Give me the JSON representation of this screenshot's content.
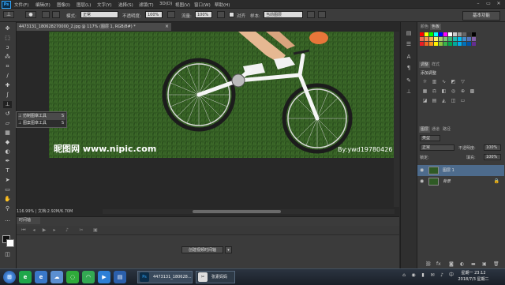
{
  "menubar": {
    "logo": "Ps",
    "items": [
      "文件(F)",
      "编辑(E)",
      "图像(I)",
      "图层(L)",
      "文字(Y)",
      "选择(S)",
      "滤镜(T)",
      "3D(D)",
      "视图(V)",
      "窗口(W)",
      "帮助(H)"
    ]
  },
  "options": {
    "mode_label": "模式:",
    "mode_value": "正常",
    "opacity_label": "不透明度:",
    "opacity_value": "100%",
    "flow_label": "流量:",
    "flow_value": "100%",
    "aligned_label": "对齐",
    "sample_label": "样本:",
    "sample_value": "当前图层",
    "workspace": "基本功能"
  },
  "document": {
    "tab_title": "4473131_180628270000_2.jpg @ 117% (图层 1, RGB/8#) *",
    "tab_close": "×",
    "status": "116.99% | 文档:2.92M/6.70M",
    "watermark_left": "昵图网 www.nipic.com",
    "watermark_right": "By:ywd19780426"
  },
  "flyout": {
    "items": [
      {
        "label": "仿制图章工具",
        "key": "S"
      },
      {
        "label": "图案图章工具",
        "key": "S"
      }
    ]
  },
  "timeline": {
    "tab": "时间轴",
    "create_button": "创建视频时间轴",
    "dropdown_arrow": "▾"
  },
  "panels": {
    "color_tabs": [
      "颜色",
      "色板"
    ],
    "adjust_tabs": [
      "调整",
      "样式"
    ],
    "adjust_title": "添加调整",
    "layers_tabs": [
      "图层",
      "通道",
      "路径"
    ],
    "kind_label": "类型",
    "blend_mode": "正常",
    "opacity_label": "不透明度:",
    "opacity_value": "100%",
    "lock_label": "锁定:",
    "fill_label": "填充:",
    "fill_value": "100%",
    "layers": [
      {
        "name": "图层 1",
        "selected": true
      },
      {
        "name": "背景",
        "selected": false
      }
    ]
  },
  "taskbar": {
    "tasks": [
      {
        "label": "4473131_180628...",
        "icon": "Ps"
      },
      {
        "label": "张素妈妈",
        "icon": "✂"
      }
    ],
    "time": "星期一 23:12",
    "date": "2018/7/3 星期二"
  },
  "colors": {
    "accent": "#31a8ff",
    "grass": "#3d6b2a",
    "selected_layer": "#4d6b8c"
  }
}
